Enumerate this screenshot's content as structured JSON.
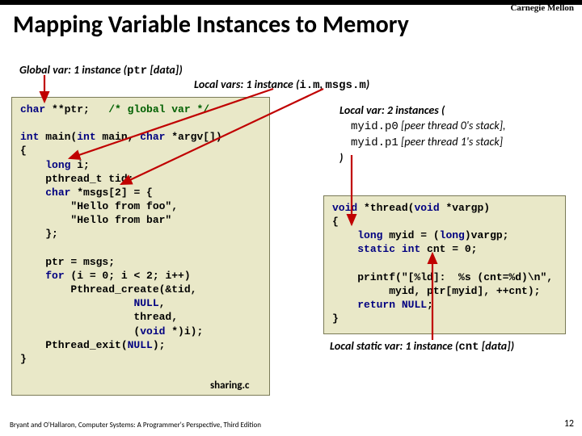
{
  "cmu": "Carnegie Mellon",
  "title": "Mapping Variable Instances to Memory",
  "globalvar": {
    "label": "Global var:",
    "text": " 1 instance (",
    "code": "ptr",
    "tail": "  [data])"
  },
  "localvars": {
    "label": "Local vars:",
    "text": " 1 instance (",
    "code1": "i.m",
    "mid": ",  ",
    "code2": "msgs.m",
    "tail": ")"
  },
  "local2": {
    "label": "Local var:",
    "head": "  2 instances (",
    "l1a": "myid.p0",
    "l1b": " [peer thread 0's stack],",
    "l2a": "myid.p1",
    "l2b": " [peer thread 1's stack]",
    "tail": ")"
  },
  "left_code": "char **ptr;   /* global var */\n\nint main(int main, char *argv[])\n{\n    long i;\n    pthread_t tid;\n    char *msgs[2] = {\n        \"Hello from foo\",\n        \"Hello from bar\"\n    };\n\n    ptr = msgs;\n    for (i = 0; i < 2; i++)\n        Pthread_create(&tid,\n                  NULL,\n                  thread,\n                  (void *)i);\n    Pthread_exit(NULL);\n}",
  "right_code": "void *thread(void *vargp)\n{\n    long myid = (long)vargp;\n    static int cnt = 0;\n\n    printf(\"[%ld]:  %s (cnt=%d)\\n\",\n         myid, ptr[myid], ++cnt);\n    return NULL;\n}",
  "sharing": "sharing.c",
  "staticvar": {
    "label": "Local static var:",
    "text": " 1 instance (",
    "code": "cnt",
    "tail": "  [data])"
  },
  "footer": "Bryant and O'Hallaron, Computer Systems: A Programmer's Perspective, Third Edition",
  "pagenum": "12"
}
